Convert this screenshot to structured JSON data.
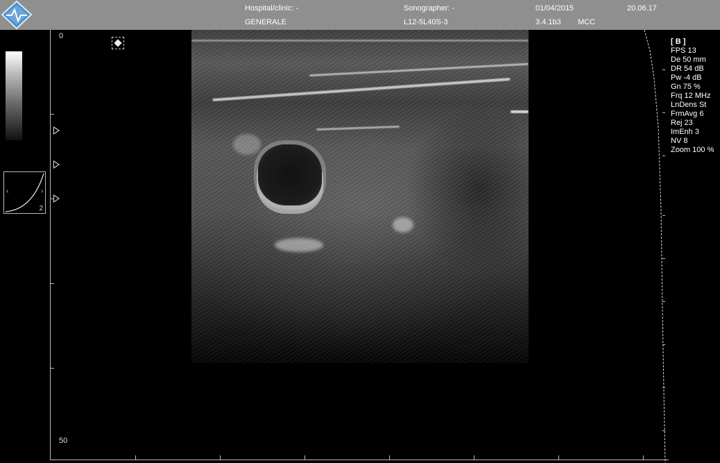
{
  "header": {
    "hospital_label": "Hospital/clinic: -",
    "department": "GENERALE",
    "sonographer_label": "Sonographer: -",
    "probe": "L12-5L40S-3",
    "date": "01/04/2015",
    "version": "3.4.1b3",
    "initials": "MCC",
    "time": "20.06.17"
  },
  "left_panel": {
    "map_number": "2",
    "chevron_left": "‹",
    "chevron_right": "›"
  },
  "depth_scale": {
    "top_label": "0",
    "bottom_label": "50"
  },
  "parameters": {
    "mode": "[ B ]",
    "items": [
      "FPS 13",
      "De 50 mm",
      "DR 54 dB",
      "Pw -4 dB",
      "Gn 75 %",
      "Frq 12 MHz",
      "LnDens St",
      "FrmAvg 6",
      "Rej 23",
      "ImEnh 3",
      "NV 8",
      "Zoom 100 %"
    ]
  },
  "icons": {
    "logo": "diamond-logo-icon",
    "freeze": "freeze-marker-icon",
    "focus": "focus-marker-icon"
  },
  "colors": {
    "header_bg": "#8f8f8f",
    "logo_blue": "#4a8ec9",
    "background": "#000000"
  }
}
